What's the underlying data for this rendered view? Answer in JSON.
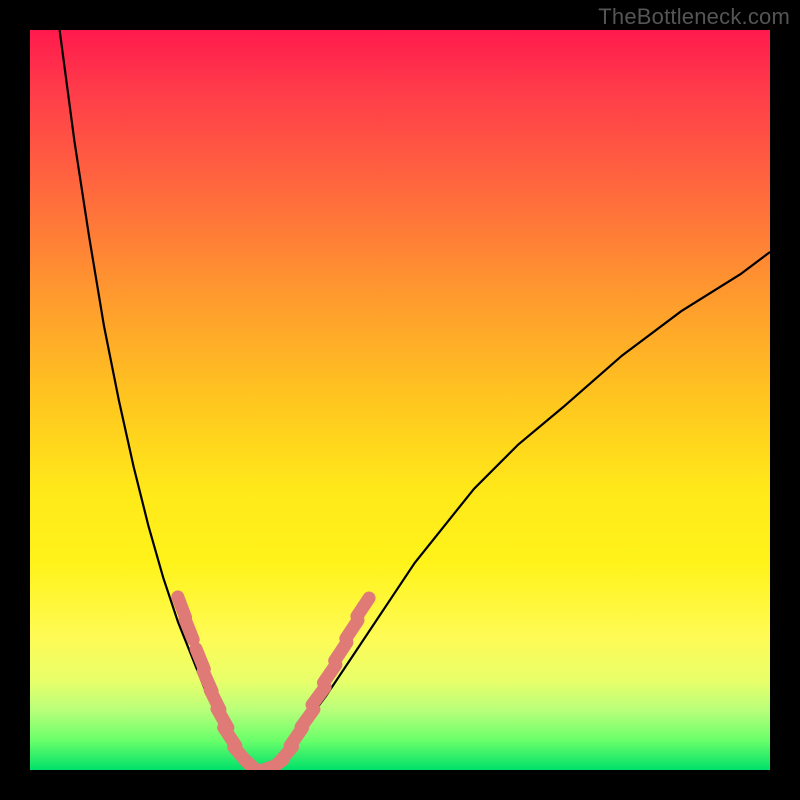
{
  "watermark": "TheBottleneck.com",
  "chart_data": {
    "type": "line",
    "title": "",
    "xlabel": "",
    "ylabel": "",
    "xlim": [
      0,
      100
    ],
    "ylim": [
      0,
      100
    ],
    "grid": false,
    "legend": false,
    "series": [
      {
        "name": "left-branch",
        "x": [
          4,
          6,
          8,
          10,
          12,
          14,
          16,
          18,
          20,
          22,
          24,
          26,
          28,
          30,
          31
        ],
        "values": [
          100,
          85,
          72,
          60,
          50,
          41,
          33,
          26,
          20,
          15,
          10,
          6,
          3,
          1,
          0
        ]
      },
      {
        "name": "right-branch",
        "x": [
          31,
          33,
          35,
          37,
          40,
          44,
          48,
          52,
          56,
          60,
          66,
          72,
          80,
          88,
          96,
          100
        ],
        "values": [
          0,
          1,
          3,
          6,
          10,
          16,
          22,
          28,
          33,
          38,
          44,
          49,
          56,
          62,
          67,
          70
        ]
      }
    ],
    "markers": {
      "name": "salmon-dashes",
      "color": "#e07a77",
      "points": [
        {
          "x": 20.5,
          "y": 22
        },
        {
          "x": 21.5,
          "y": 19
        },
        {
          "x": 23,
          "y": 15
        },
        {
          "x": 24,
          "y": 12
        },
        {
          "x": 25,
          "y": 9.5
        },
        {
          "x": 26,
          "y": 7
        },
        {
          "x": 27,
          "y": 4.5
        },
        {
          "x": 28.5,
          "y": 2
        },
        {
          "x": 30,
          "y": 0.5
        },
        {
          "x": 31.5,
          "y": 0
        },
        {
          "x": 33,
          "y": 0.5
        },
        {
          "x": 34.5,
          "y": 2
        },
        {
          "x": 36,
          "y": 4.5
        },
        {
          "x": 37.5,
          "y": 7
        },
        {
          "x": 39,
          "y": 10
        },
        {
          "x": 40.5,
          "y": 13
        },
        {
          "x": 42,
          "y": 16
        },
        {
          "x": 43.5,
          "y": 19
        },
        {
          "x": 45,
          "y": 22
        }
      ]
    },
    "gradient_stops": [
      {
        "pos": 0,
        "color": "#ff1a4d"
      },
      {
        "pos": 50,
        "color": "#ffe81a"
      },
      {
        "pos": 100,
        "color": "#00e06a"
      }
    ]
  }
}
